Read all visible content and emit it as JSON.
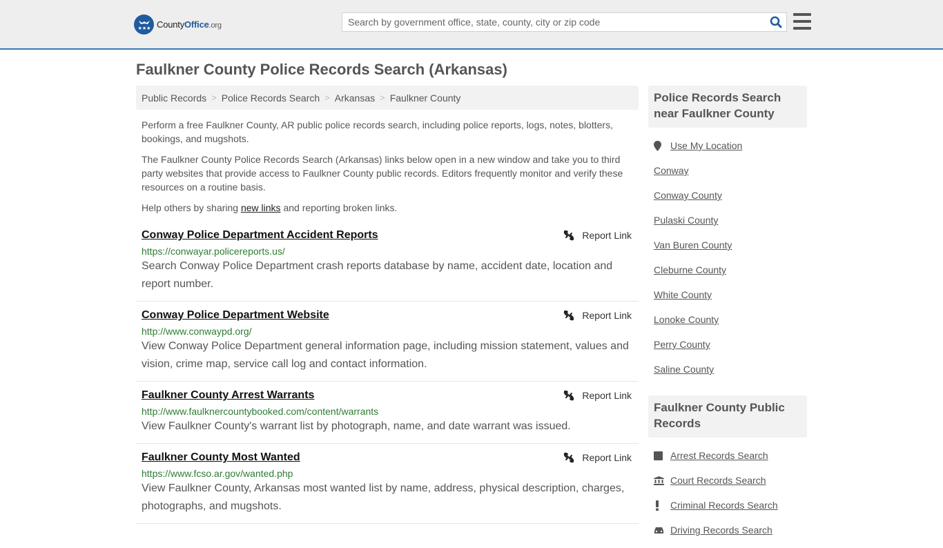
{
  "header": {
    "logo": {
      "name": "County",
      "office": "Office",
      "tld": ".org"
    },
    "search_placeholder": "Search by government office, state, county, city or zip code",
    "search_value": ""
  },
  "page_title": "Faulkner County Police Records Search (Arkansas)",
  "breadcrumb": [
    "Public Records",
    "Police Records Search",
    "Arkansas",
    "Faulkner County"
  ],
  "intro": {
    "p1": "Perform a free Faulkner County, AR public police records search, including police reports, logs, notes, blotters, bookings, and mugshots.",
    "p2": "The Faulkner County Police Records Search (Arkansas) links below open in a new window and take you to third party websites that provide access to Faulkner County public records. Editors frequently monitor and verify these resources on a routine basis.",
    "p3_before": "Help others by sharing ",
    "p3_link": "new links",
    "p3_after": " and reporting broken links."
  },
  "report_label": "Report Link",
  "results": [
    {
      "title": "Conway Police Department Accident Reports",
      "url": "https://conwayar.policereports.us/",
      "desc": "Search Conway Police Department crash reports database by name, accident date, location and report number."
    },
    {
      "title": "Conway Police Department Website",
      "url": "http://www.conwaypd.org/",
      "desc": "View Conway Police Department general information page, including mission statement, values and vision, crime map, service call log and contact information."
    },
    {
      "title": "Faulkner County Arrest Warrants",
      "url": "http://www.faulknercountybooked.com/content/warrants",
      "desc": "View Faulkner County's warrant list by photograph, name, and date warrant was issued."
    },
    {
      "title": "Faulkner County Most Wanted",
      "url": "https://www.fcso.ar.gov/wanted.php",
      "desc": "View Faulkner County, Arkansas most wanted list by name, address, physical description, charges, photographs, and mugshots."
    }
  ],
  "sidebar": {
    "nearby": {
      "heading": "Police Records Search near Faulkner County",
      "use_location": "Use My Location",
      "items": [
        "Conway",
        "Conway County",
        "Pulaski County",
        "Van Buren County",
        "Cleburne County",
        "White County",
        "Lonoke County",
        "Perry County",
        "Saline County"
      ]
    },
    "public_records": {
      "heading": "Faulkner County Public Records",
      "items": [
        {
          "label": "Arrest Records Search",
          "icon": "square-icon"
        },
        {
          "label": "Court Records Search",
          "icon": "courthouse-icon"
        },
        {
          "label": "Criminal Records Search",
          "icon": "exclamation-icon"
        },
        {
          "label": "Driving Records Search",
          "icon": "car-icon"
        }
      ]
    }
  },
  "colors": {
    "accent_blue": "#337ab7",
    "logo_blue": "#1f5c9e",
    "url_green": "#2e7d32",
    "header_bg": "#eeeeee"
  }
}
